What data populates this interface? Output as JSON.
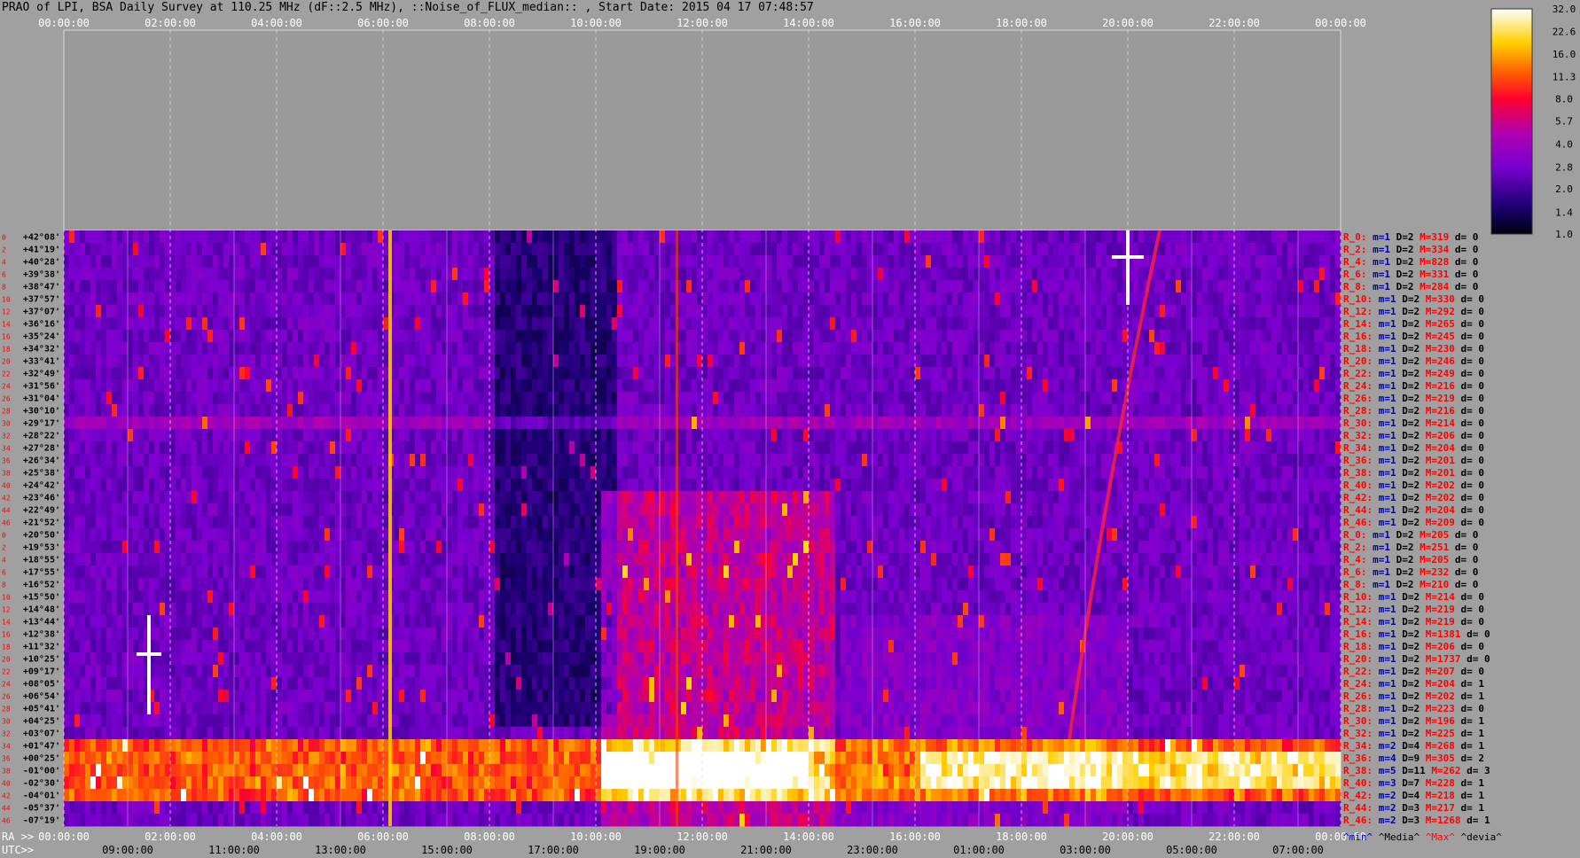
{
  "title": "PRAO of LPI, BSA Daily Survey at 110.25 MHz (dF::2.5 MHz), ::Noise_of_FLUX_median:: , Start Date: 2015 04 17 07:48:57",
  "chart_data": {
    "type": "heatmap",
    "title": "PRAO of LPI, BSA Daily Survey at 110.25 MHz (dF::2.5 MHz), ::Noise_of_FLUX_median:: , Start Date: 2015 04 17 07:48:57",
    "top_axis_ticks": [
      "00:00:00",
      "02:00:00",
      "04:00:00",
      "06:00:00",
      "08:00:00",
      "10:00:00",
      "12:00:00",
      "14:00:00",
      "16:00:00",
      "18:00:00",
      "20:00:00",
      "22:00:00",
      "00:00:00"
    ],
    "ra_axis_label": "RA >>",
    "ra_ticks": [
      "00:00:00",
      "02:00:00",
      "04:00:00",
      "06:00:00",
      "08:00:00",
      "10:00:00",
      "12:00:00",
      "14:00:00",
      "16:00:00",
      "18:00:00",
      "20:00:00",
      "22:00:00",
      "00:00:00"
    ],
    "utc_axis_label": "UTC>>",
    "utc_ticks": [
      "09:00:00",
      "11:00:00",
      "13:00:00",
      "15:00:00",
      "17:00:00",
      "19:00:00",
      "21:00:00",
      "23:00:00",
      "01:00:00",
      "03:00:00",
      "05:00:00",
      "07:00:00"
    ],
    "dec_labels": [
      "+42°08'",
      "+41°19'",
      "+40°28'",
      "+39°38'",
      "+38°47'",
      "+37°57'",
      "+37°07'",
      "+36°16'",
      "+35°24'",
      "+34°32'",
      "+33°41'",
      "+32°49'",
      "+31°56'",
      "+31°04'",
      "+30°10'",
      "+29°17'",
      "+28°22'",
      "+27°28'",
      "+26°34'",
      "+25°38'",
      "+24°42'",
      "+23°46'",
      "+22°49'",
      "+21°52'",
      "+20°50'",
      "+19°53'",
      "+18°55'",
      "+17°55'",
      "+16°52'",
      "+15°50'",
      "+14°48'",
      "+13°44'",
      "+12°38'",
      "+11°32'",
      "+10°25'",
      "+09°17'",
      "+08°05'",
      "+06°54'",
      "+05°41'",
      "+04°25'",
      "+03°07'",
      "+01°47'",
      "+00°25'",
      "-01°00'",
      "-02°30'",
      "-04°01'",
      "-05°37'",
      "-07°19'"
    ],
    "beam_index_labels": [
      "0",
      "2",
      "4",
      "6",
      "8",
      "10",
      "12",
      "14",
      "16",
      "18",
      "20",
      "22",
      "24",
      "26",
      "28",
      "30",
      "32",
      "34",
      "36",
      "38",
      "40",
      "42",
      "44",
      "46",
      "0",
      "2",
      "4",
      "6",
      "8",
      "10",
      "12",
      "14",
      "16",
      "18",
      "20",
      "22",
      "24",
      "26",
      "28",
      "30",
      "32",
      "34",
      "36",
      "38",
      "40",
      "42",
      "44",
      "46"
    ],
    "colorbar": {
      "ticks": [
        32.0,
        22.6,
        16.0,
        11.3,
        8.0,
        5.7,
        4.0,
        2.8,
        2.0,
        1.4,
        1.0
      ],
      "scale": "log",
      "range": [
        1.0,
        32.0
      ]
    },
    "stats_columns": [
      "^min^",
      "^Media^",
      "^Max^",
      "^devia^"
    ],
    "stats": [
      [
        "R_0:",
        "1",
        "2",
        "319",
        "0"
      ],
      [
        "R_2:",
        "1",
        "2",
        "334",
        "0"
      ],
      [
        "R_4:",
        "1",
        "2",
        "828",
        "0"
      ],
      [
        "R_6:",
        "1",
        "2",
        "331",
        "0"
      ],
      [
        "R_8:",
        "1",
        "2",
        "284",
        "0"
      ],
      [
        "R_10:",
        "1",
        "2",
        "330",
        "0"
      ],
      [
        "R_12:",
        "1",
        "2",
        "292",
        "0"
      ],
      [
        "R_14:",
        "1",
        "2",
        "265",
        "0"
      ],
      [
        "R_16:",
        "1",
        "2",
        "245",
        "0"
      ],
      [
        "R_18:",
        "1",
        "2",
        "230",
        "0"
      ],
      [
        "R_20:",
        "1",
        "2",
        "246",
        "0"
      ],
      [
        "R_22:",
        "1",
        "2",
        "249",
        "0"
      ],
      [
        "R_24:",
        "1",
        "2",
        "216",
        "0"
      ],
      [
        "R_26:",
        "1",
        "2",
        "219",
        "0"
      ],
      [
        "R_28:",
        "1",
        "2",
        "216",
        "0"
      ],
      [
        "R_30:",
        "1",
        "2",
        "214",
        "0"
      ],
      [
        "R_32:",
        "1",
        "2",
        "206",
        "0"
      ],
      [
        "R_34:",
        "1",
        "2",
        "204",
        "0"
      ],
      [
        "R_36:",
        "1",
        "2",
        "201",
        "0"
      ],
      [
        "R_38:",
        "1",
        "2",
        "201",
        "0"
      ],
      [
        "R_40:",
        "1",
        "2",
        "202",
        "0"
      ],
      [
        "R_42:",
        "1",
        "2",
        "202",
        "0"
      ],
      [
        "R_44:",
        "1",
        "2",
        "204",
        "0"
      ],
      [
        "R_46:",
        "1",
        "2",
        "209",
        "0"
      ],
      [
        "R_0:",
        "1",
        "2",
        "205",
        "0"
      ],
      [
        "R_2:",
        "1",
        "2",
        "251",
        "0"
      ],
      [
        "R_4:",
        "1",
        "2",
        "205",
        "0"
      ],
      [
        "R_6:",
        "1",
        "2",
        "232",
        "0"
      ],
      [
        "R_8:",
        "1",
        "2",
        "210",
        "0"
      ],
      [
        "R_10:",
        "1",
        "2",
        "214",
        "0"
      ],
      [
        "R_12:",
        "1",
        "2",
        "219",
        "0"
      ],
      [
        "R_14:",
        "1",
        "2",
        "219",
        "0"
      ],
      [
        "R_16:",
        "1",
        "2",
        "1381",
        "0"
      ],
      [
        "R_18:",
        "1",
        "2",
        "206",
        "0"
      ],
      [
        "R_20:",
        "1",
        "2",
        "1737",
        "0"
      ],
      [
        "R_22:",
        "1",
        "2",
        "207",
        "0"
      ],
      [
        "R_24:",
        "1",
        "2",
        "204",
        "1"
      ],
      [
        "R_26:",
        "1",
        "2",
        "202",
        "1"
      ],
      [
        "R_28:",
        "1",
        "2",
        "223",
        "0"
      ],
      [
        "R_30:",
        "1",
        "2",
        "196",
        "1"
      ],
      [
        "R_32:",
        "1",
        "2",
        "225",
        "1"
      ],
      [
        "R_34:",
        "2",
        "4",
        "268",
        "1"
      ],
      [
        "R_36:",
        "4",
        "9",
        "305",
        "2"
      ],
      [
        "R_38:",
        "5",
        "11",
        "262",
        "3"
      ],
      [
        "R_40:",
        "3",
        "7",
        "228",
        "1"
      ],
      [
        "R_42:",
        "2",
        "4",
        "218",
        "1"
      ],
      [
        "R_44:",
        "2",
        "3",
        "217",
        "1"
      ],
      [
        "R_46:",
        "2",
        "3",
        "1268",
        "1"
      ]
    ],
    "grid": true
  }
}
